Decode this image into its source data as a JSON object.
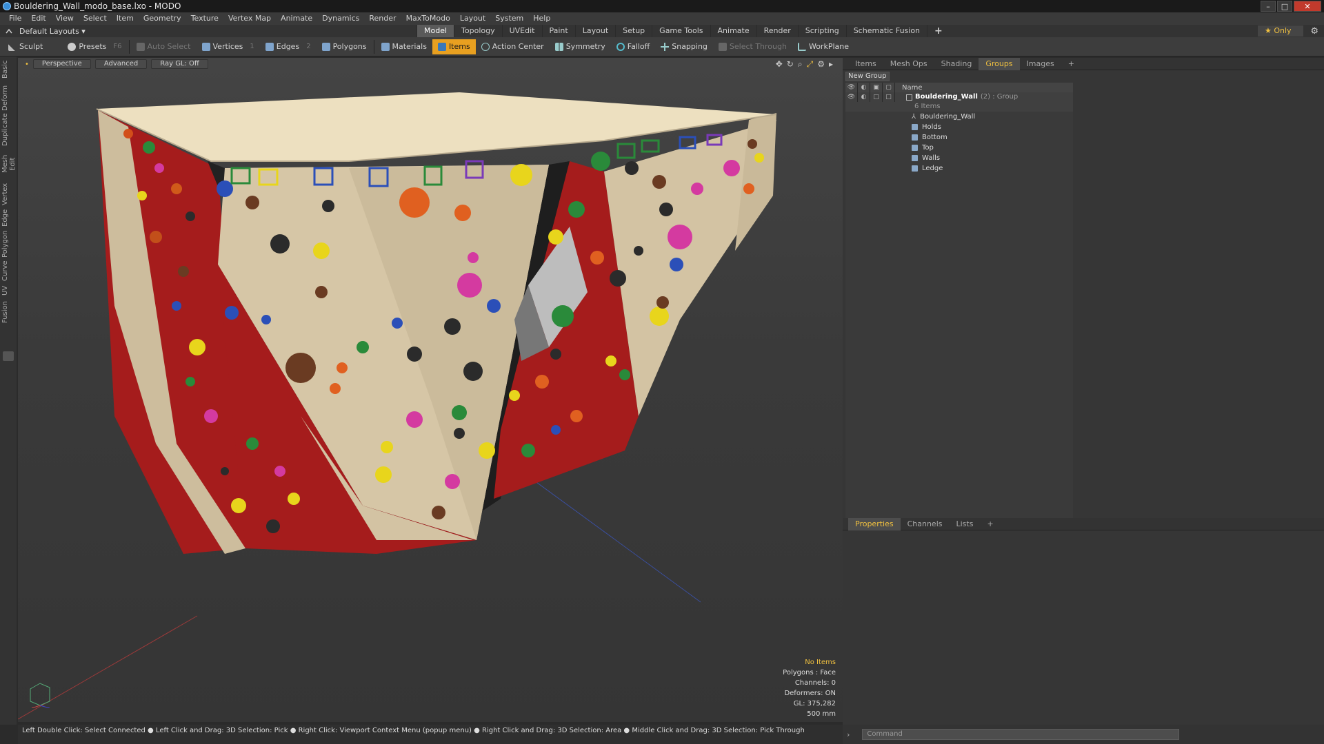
{
  "window": {
    "title": "Bouldering_Wall_modo_base.lxo - MODO",
    "btn_min": "–",
    "btn_max": "□",
    "btn_close": "✕"
  },
  "menu": [
    "File",
    "Edit",
    "View",
    "Select",
    "Item",
    "Geometry",
    "Texture",
    "Vertex Map",
    "Animate",
    "Dynamics",
    "Render",
    "MaxToModo",
    "Layout",
    "System",
    "Help"
  ],
  "layout": {
    "selector": "Default Layouts ▾",
    "tabs": [
      "Model",
      "Topology",
      "UVEdit",
      "Paint",
      "Layout",
      "Setup",
      "Game Tools",
      "Animate",
      "Render",
      "Scripting",
      "Schematic Fusion"
    ],
    "active_tab": "Model",
    "plus": "+",
    "only": "★ Only"
  },
  "toolbar": {
    "sculpt": "Sculpt",
    "presets": "Presets",
    "presets_key": "F6",
    "auto_select": "Auto Select",
    "vertices": "Vertices",
    "vertices_count": "1",
    "edges": "Edges",
    "edges_count": "2",
    "polygons": "Polygons",
    "materials": "Materials",
    "items": "Items",
    "action_center": "Action Center",
    "symmetry": "Symmetry",
    "falloff": "Falloff",
    "snapping": "Snapping",
    "select_through": "Select Through",
    "workplane": "WorkPlane"
  },
  "left_tabs": [
    "Basic",
    "Deform",
    "Duplicate",
    "Mesh Edit",
    "Vertex",
    "Edge",
    "Polygon",
    "Curve",
    "UV",
    "Fusion"
  ],
  "viewport": {
    "perspective": "Perspective",
    "advanced": "Advanced",
    "raygl": "Ray GL: Off",
    "info": {
      "no_items": "No Items",
      "polygons": "Polygons : Face",
      "channels": "Channels: 0",
      "deformers": "Deformers: ON",
      "gl": "GL: 375,282",
      "scale": "500 mm"
    }
  },
  "right_panel": {
    "tabs": [
      "Items",
      "Mesh Ops",
      "Shading",
      "Groups",
      "Images"
    ],
    "active_tab": "Groups",
    "plus": "+",
    "new_group": "New Group",
    "name_col": "Name",
    "group_name": "Bouldering_Wall",
    "group_meta": "(2) : Group",
    "group_count": "6 Items",
    "items": [
      "Bouldering_Wall",
      "Holds",
      "Bottom",
      "Top",
      "Walls",
      "Ledge"
    ],
    "bottom_tabs": [
      "Properties",
      "Channels",
      "Lists"
    ],
    "bottom_active": "Properties",
    "command_placeholder": "Command"
  },
  "status": "Left Double Click: Select Connected ● Left Click and Drag: 3D Selection: Pick ● Right Click: Viewport Context Menu (popup menu) ● Right Click and Drag: 3D Selection: Area ● Middle Click and Drag: 3D Selection: Pick Through",
  "colors": {
    "accent": "#e8a020",
    "wall_beige": "#d6c6a6",
    "wall_red": "#a51c1c",
    "top_cream": "#ede0c0"
  }
}
